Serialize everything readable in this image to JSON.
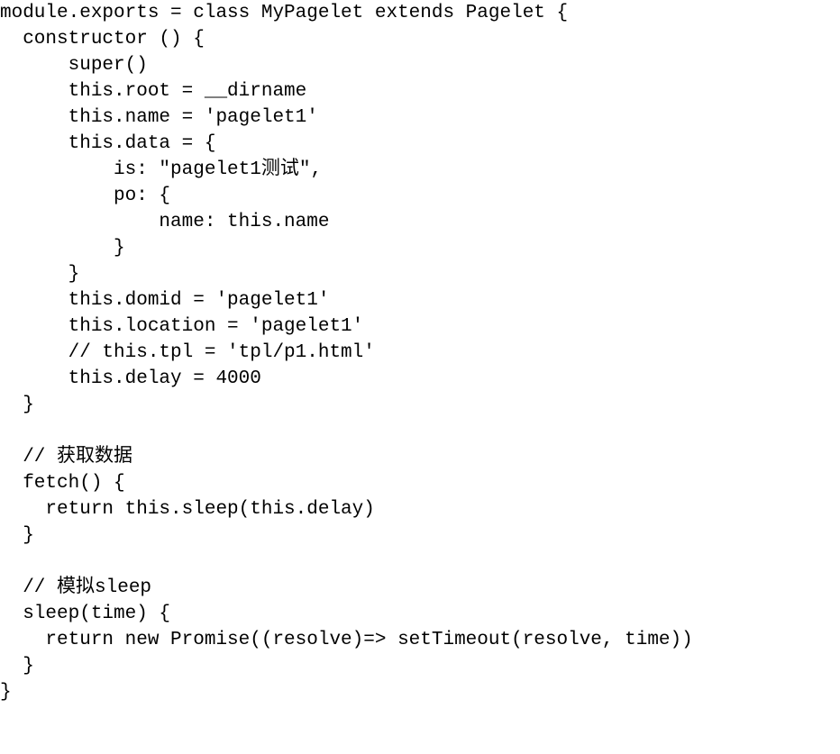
{
  "code": {
    "lines": [
      "module.exports = class MyPagelet extends Pagelet {",
      "  constructor () {",
      "      super()",
      "      this.root = __dirname",
      "      this.name = 'pagelet1'",
      "      this.data = {",
      "          is: \"pagelet1测试\",",
      "          po: {",
      "              name: this.name",
      "          }",
      "      }",
      "      this.domid = 'pagelet1'",
      "      this.location = 'pagelet1'",
      "      // this.tpl = 'tpl/p1.html'",
      "      this.delay = 4000",
      "  }",
      "",
      "  // 获取数据",
      "  fetch() {",
      "    return this.sleep(this.delay)",
      "  }",
      "",
      "  // 模拟sleep",
      "  sleep(time) {",
      "    return new Promise((resolve)=> setTimeout(resolve, time))",
      "  }",
      "}"
    ]
  }
}
